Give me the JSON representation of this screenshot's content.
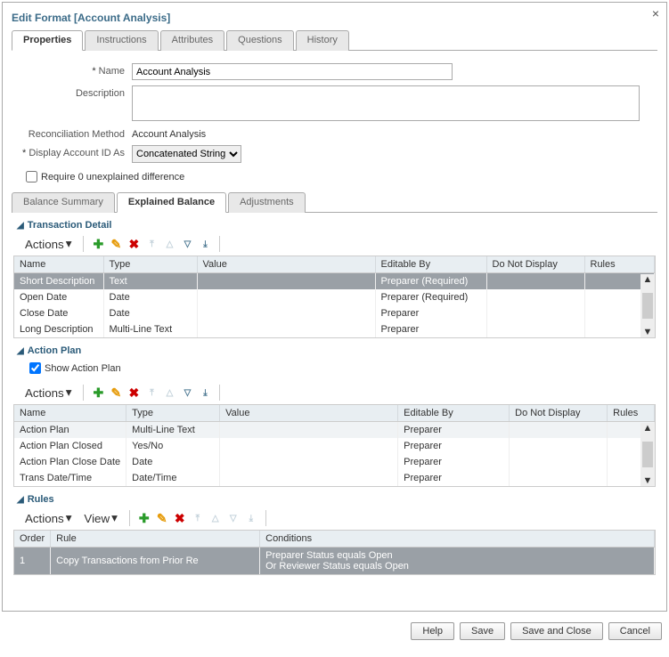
{
  "dialog": {
    "title": "Edit Format [Account Analysis]"
  },
  "tabs": {
    "properties": "Properties",
    "instructions": "Instructions",
    "attributes": "Attributes",
    "questions": "Questions",
    "history": "History"
  },
  "form": {
    "name_label": "Name",
    "name_value": "Account Analysis",
    "description_label": "Description",
    "description_value": "",
    "recon_label": "Reconciliation Method",
    "recon_value": "Account Analysis",
    "display_label": "Display Account ID As",
    "display_value": "Concatenated String",
    "require0_label": "Require 0 unexplained difference"
  },
  "subtabs": {
    "balance_summary": "Balance Summary",
    "explained_balance": "Explained Balance",
    "adjustments": "Adjustments"
  },
  "sections": {
    "transaction_detail": "Transaction Detail",
    "action_plan": "Action Plan",
    "rules": "Rules"
  },
  "toolbar": {
    "actions": "Actions",
    "view": "View"
  },
  "action_plan_check": {
    "label": "Show Action Plan",
    "checked": true
  },
  "columns": {
    "name": "Name",
    "type": "Type",
    "value": "Value",
    "editable_by": "Editable By",
    "do_not_display": "Do Not Display",
    "rules": "Rules",
    "order": "Order",
    "rule": "Rule",
    "conditions": "Conditions"
  },
  "transaction_rows": [
    {
      "name": "Short Description",
      "type": "Text",
      "value": "",
      "editable_by": "Preparer (Required)",
      "dnd": "",
      "rules": ""
    },
    {
      "name": "Open Date",
      "type": "Date",
      "value": "",
      "editable_by": "Preparer (Required)",
      "dnd": "",
      "rules": ""
    },
    {
      "name": "Close Date",
      "type": "Date",
      "value": "",
      "editable_by": "Preparer",
      "dnd": "",
      "rules": ""
    },
    {
      "name": "Long Description",
      "type": "Multi-Line Text",
      "value": "",
      "editable_by": "Preparer",
      "dnd": "",
      "rules": ""
    }
  ],
  "action_plan_rows": [
    {
      "name": "Action Plan",
      "type": "Multi-Line Text",
      "value": "",
      "editable_by": "Preparer",
      "dnd": "",
      "rules": ""
    },
    {
      "name": "Action Plan Closed",
      "type": "Yes/No",
      "value": "",
      "editable_by": "Preparer",
      "dnd": "",
      "rules": ""
    },
    {
      "name": "Action Plan Close Date",
      "type": "Date",
      "value": "",
      "editable_by": "Preparer",
      "dnd": "",
      "rules": ""
    },
    {
      "name": "Trans  Date/Time",
      "type": "Date/Time",
      "value": "",
      "editable_by": "Preparer",
      "dnd": "",
      "rules": ""
    }
  ],
  "rules_rows": [
    {
      "order": "1",
      "rule": "Copy Transactions from Prior Re",
      "conditions": "Preparer Status equals Open\nOr Reviewer Status equals Open"
    }
  ],
  "footer": {
    "help": "Help",
    "save": "Save",
    "save_close": "Save and Close",
    "cancel": "Cancel"
  }
}
